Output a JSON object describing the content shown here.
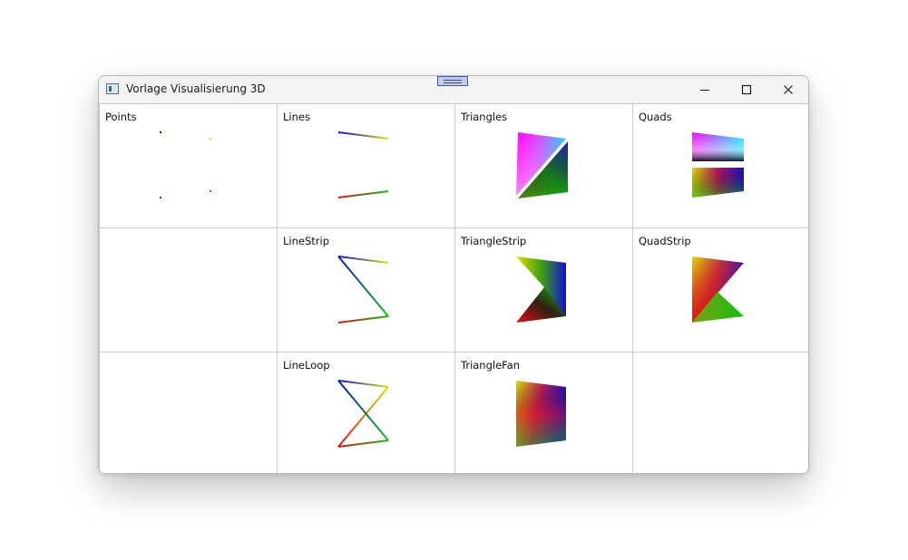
{
  "window": {
    "title": "Vorlage Visualisierung 3D",
    "controls": {
      "minimize": "minimize-icon",
      "maximize": "maximize-icon",
      "close": "close-icon"
    }
  },
  "cells": [
    {
      "label": "Points"
    },
    {
      "label": "Lines"
    },
    {
      "label": "Triangles"
    },
    {
      "label": "Quads"
    },
    {
      "label": ""
    },
    {
      "label": "LineStrip"
    },
    {
      "label": "TriangleStrip"
    },
    {
      "label": "QuadStrip"
    },
    {
      "label": ""
    },
    {
      "label": "LineLoop"
    },
    {
      "label": "TriangleFan"
    },
    {
      "label": ""
    }
  ],
  "colors": {
    "blue": "#1010d0",
    "yellow": "#e0e000",
    "green": "#10c010",
    "red": "#e01010",
    "magenta": "#ff00ff",
    "cyan": "#00e0ff",
    "black": "#000000",
    "white": "#ffffff"
  }
}
